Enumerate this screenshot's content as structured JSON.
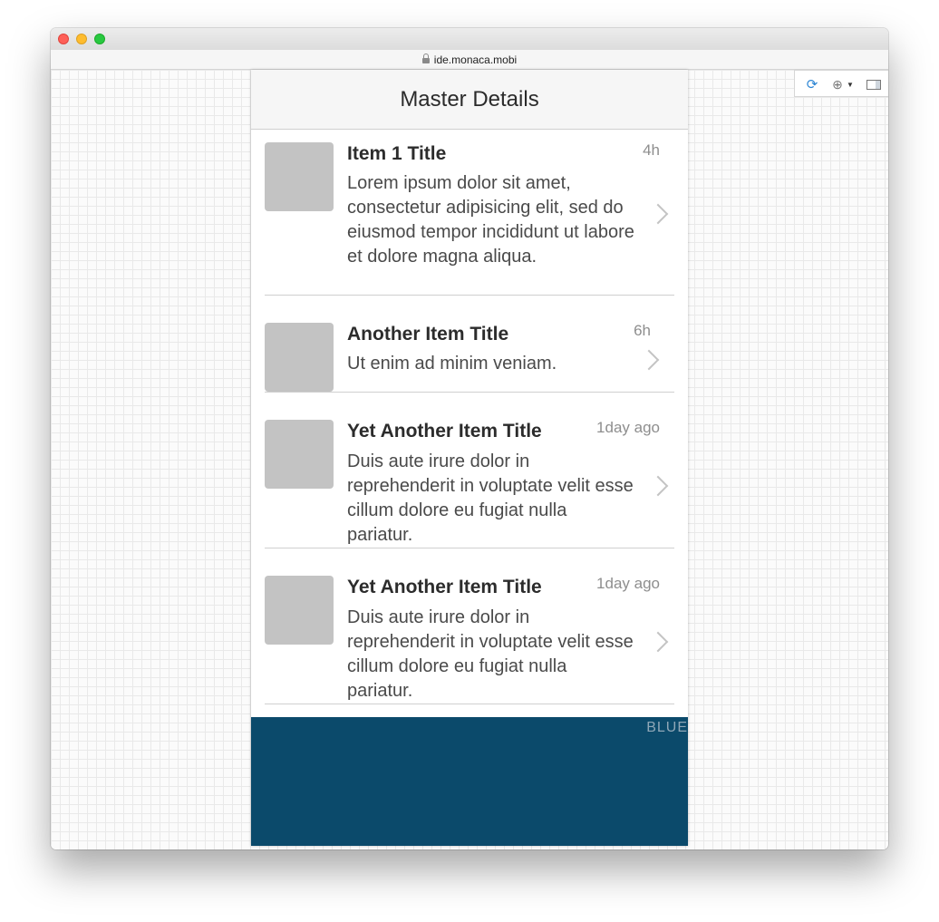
{
  "browser": {
    "url": "ide.monaca.mobi"
  },
  "toolbar": {
    "refresh_icon": "refresh-icon",
    "globe_icon": "globe-icon",
    "panel_icon": "panel-icon"
  },
  "app": {
    "title": "Master Details",
    "items": [
      {
        "title": "Item 1 Title",
        "time": "4h",
        "desc": "Lorem ipsum dolor sit amet, consectetur adipisicing elit, sed do eiusmod tempor incididunt ut labore et dolore magna aliqua."
      },
      {
        "title": "Another Item Title",
        "time": "6h",
        "desc": "Ut enim ad minim veniam."
      },
      {
        "title": "Yet Another Item Title",
        "time": "1day ago",
        "desc": "Duis aute irure dolor in reprehenderit in voluptate velit esse cillum dolore eu fugiat nulla pariatur."
      },
      {
        "title": "Yet Another Item Title",
        "time": "1day ago",
        "desc": "Duis aute irure dolor in reprehenderit in voluptate velit esse cillum dolore eu fugiat nulla pariatur."
      }
    ],
    "footer_label": "BLUE"
  },
  "colors": {
    "footer_bg": "#0b4a6b",
    "thumb": "#c3c3c3",
    "nav_bg": "#f6f6f6"
  }
}
